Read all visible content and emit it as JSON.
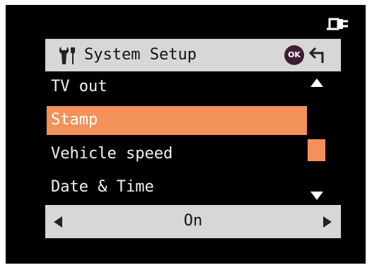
{
  "header": {
    "title": "System Setup",
    "ok_label": "OK"
  },
  "icons": {
    "power": "power-plug-icon",
    "tools": "tools-icon",
    "back": "back-arrow-icon",
    "scroll_up": "scroll-up-arrow-icon",
    "scroll_down": "scroll-down-arrow-icon",
    "value_left": "left-arrow-icon",
    "value_right": "right-arrow-icon"
  },
  "menu": {
    "items": [
      {
        "label": "TV out",
        "selected": false
      },
      {
        "label": "Stamp",
        "selected": true
      },
      {
        "label": "Vehicle speed",
        "selected": false
      },
      {
        "label": "Date & Time",
        "selected": false
      }
    ]
  },
  "value_selector": {
    "value": "On"
  },
  "colors": {
    "background": "#000000",
    "header_bar": "#d7d7d7",
    "selection": "#f3915b",
    "ok_button": "#3d1f35"
  }
}
